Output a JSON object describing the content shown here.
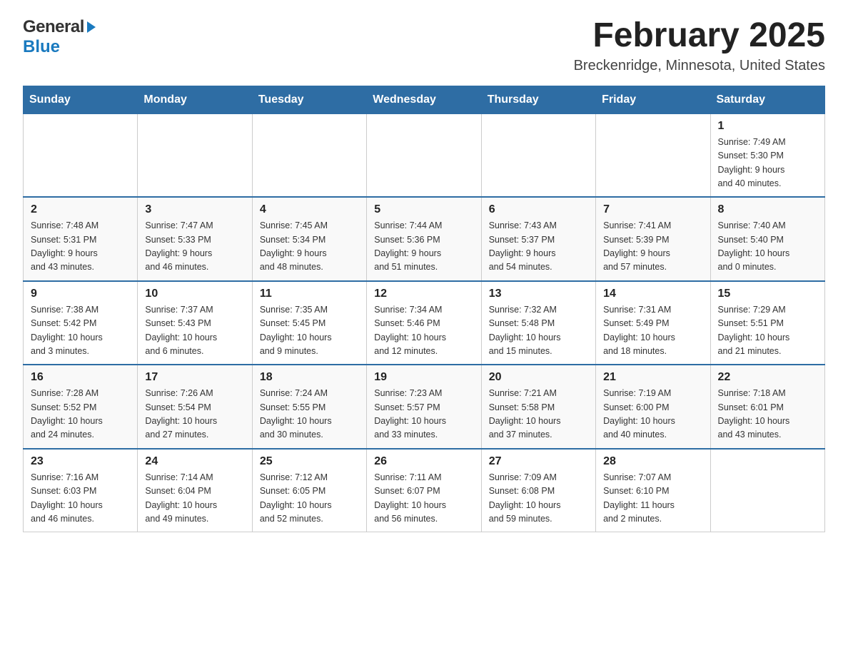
{
  "header": {
    "logo": {
      "general": "General",
      "blue": "Blue",
      "arrow": "▶"
    },
    "title": "February 2025",
    "location": "Breckenridge, Minnesota, United States"
  },
  "weekdays": [
    "Sunday",
    "Monday",
    "Tuesday",
    "Wednesday",
    "Thursday",
    "Friday",
    "Saturday"
  ],
  "weeks": [
    [
      {
        "day": "",
        "info": ""
      },
      {
        "day": "",
        "info": ""
      },
      {
        "day": "",
        "info": ""
      },
      {
        "day": "",
        "info": ""
      },
      {
        "day": "",
        "info": ""
      },
      {
        "day": "",
        "info": ""
      },
      {
        "day": "1",
        "info": "Sunrise: 7:49 AM\nSunset: 5:30 PM\nDaylight: 9 hours\nand 40 minutes."
      }
    ],
    [
      {
        "day": "2",
        "info": "Sunrise: 7:48 AM\nSunset: 5:31 PM\nDaylight: 9 hours\nand 43 minutes."
      },
      {
        "day": "3",
        "info": "Sunrise: 7:47 AM\nSunset: 5:33 PM\nDaylight: 9 hours\nand 46 minutes."
      },
      {
        "day": "4",
        "info": "Sunrise: 7:45 AM\nSunset: 5:34 PM\nDaylight: 9 hours\nand 48 minutes."
      },
      {
        "day": "5",
        "info": "Sunrise: 7:44 AM\nSunset: 5:36 PM\nDaylight: 9 hours\nand 51 minutes."
      },
      {
        "day": "6",
        "info": "Sunrise: 7:43 AM\nSunset: 5:37 PM\nDaylight: 9 hours\nand 54 minutes."
      },
      {
        "day": "7",
        "info": "Sunrise: 7:41 AM\nSunset: 5:39 PM\nDaylight: 9 hours\nand 57 minutes."
      },
      {
        "day": "8",
        "info": "Sunrise: 7:40 AM\nSunset: 5:40 PM\nDaylight: 10 hours\nand 0 minutes."
      }
    ],
    [
      {
        "day": "9",
        "info": "Sunrise: 7:38 AM\nSunset: 5:42 PM\nDaylight: 10 hours\nand 3 minutes."
      },
      {
        "day": "10",
        "info": "Sunrise: 7:37 AM\nSunset: 5:43 PM\nDaylight: 10 hours\nand 6 minutes."
      },
      {
        "day": "11",
        "info": "Sunrise: 7:35 AM\nSunset: 5:45 PM\nDaylight: 10 hours\nand 9 minutes."
      },
      {
        "day": "12",
        "info": "Sunrise: 7:34 AM\nSunset: 5:46 PM\nDaylight: 10 hours\nand 12 minutes."
      },
      {
        "day": "13",
        "info": "Sunrise: 7:32 AM\nSunset: 5:48 PM\nDaylight: 10 hours\nand 15 minutes."
      },
      {
        "day": "14",
        "info": "Sunrise: 7:31 AM\nSunset: 5:49 PM\nDaylight: 10 hours\nand 18 minutes."
      },
      {
        "day": "15",
        "info": "Sunrise: 7:29 AM\nSunset: 5:51 PM\nDaylight: 10 hours\nand 21 minutes."
      }
    ],
    [
      {
        "day": "16",
        "info": "Sunrise: 7:28 AM\nSunset: 5:52 PM\nDaylight: 10 hours\nand 24 minutes."
      },
      {
        "day": "17",
        "info": "Sunrise: 7:26 AM\nSunset: 5:54 PM\nDaylight: 10 hours\nand 27 minutes."
      },
      {
        "day": "18",
        "info": "Sunrise: 7:24 AM\nSunset: 5:55 PM\nDaylight: 10 hours\nand 30 minutes."
      },
      {
        "day": "19",
        "info": "Sunrise: 7:23 AM\nSunset: 5:57 PM\nDaylight: 10 hours\nand 33 minutes."
      },
      {
        "day": "20",
        "info": "Sunrise: 7:21 AM\nSunset: 5:58 PM\nDaylight: 10 hours\nand 37 minutes."
      },
      {
        "day": "21",
        "info": "Sunrise: 7:19 AM\nSunset: 6:00 PM\nDaylight: 10 hours\nand 40 minutes."
      },
      {
        "day": "22",
        "info": "Sunrise: 7:18 AM\nSunset: 6:01 PM\nDaylight: 10 hours\nand 43 minutes."
      }
    ],
    [
      {
        "day": "23",
        "info": "Sunrise: 7:16 AM\nSunset: 6:03 PM\nDaylight: 10 hours\nand 46 minutes."
      },
      {
        "day": "24",
        "info": "Sunrise: 7:14 AM\nSunset: 6:04 PM\nDaylight: 10 hours\nand 49 minutes."
      },
      {
        "day": "25",
        "info": "Sunrise: 7:12 AM\nSunset: 6:05 PM\nDaylight: 10 hours\nand 52 minutes."
      },
      {
        "day": "26",
        "info": "Sunrise: 7:11 AM\nSunset: 6:07 PM\nDaylight: 10 hours\nand 56 minutes."
      },
      {
        "day": "27",
        "info": "Sunrise: 7:09 AM\nSunset: 6:08 PM\nDaylight: 10 hours\nand 59 minutes."
      },
      {
        "day": "28",
        "info": "Sunrise: 7:07 AM\nSunset: 6:10 PM\nDaylight: 11 hours\nand 2 minutes."
      },
      {
        "day": "",
        "info": ""
      }
    ]
  ]
}
